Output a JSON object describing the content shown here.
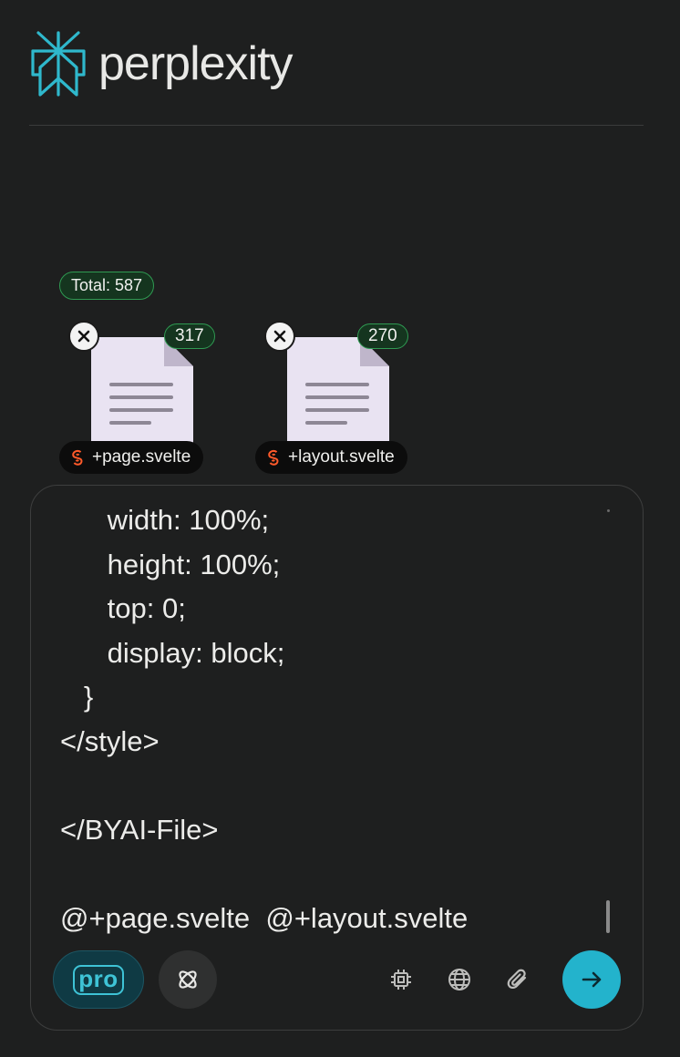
{
  "app": {
    "brand_name": "perplexity",
    "logo_icon": "perplexity-logo-icon",
    "accent_color": "#23b3cc",
    "badge_color": "#2f9a52"
  },
  "attachments": {
    "total_label": "Total: 587",
    "files": [
      {
        "name": "+page.svelte",
        "count": "317",
        "icon": "svelte-icon"
      },
      {
        "name": "+layout.svelte",
        "count": "270",
        "icon": "svelte-icon"
      }
    ]
  },
  "composer": {
    "lines": [
      "      width: 100%;",
      "      height: 100%;",
      "      top: 0;",
      "      display: block;",
      "   }",
      "</style>",
      "",
      "</BYAI-File>",
      "",
      "@+page.svelte  @+layout.svelte"
    ]
  },
  "toolbar": {
    "pro_label": "pro",
    "focus_icon": "atom-icon",
    "chip_icon": "cpu-chip-icon",
    "web_icon": "globe-icon",
    "attach_icon": "paperclip-icon",
    "submit_icon": "arrow-right-icon"
  }
}
